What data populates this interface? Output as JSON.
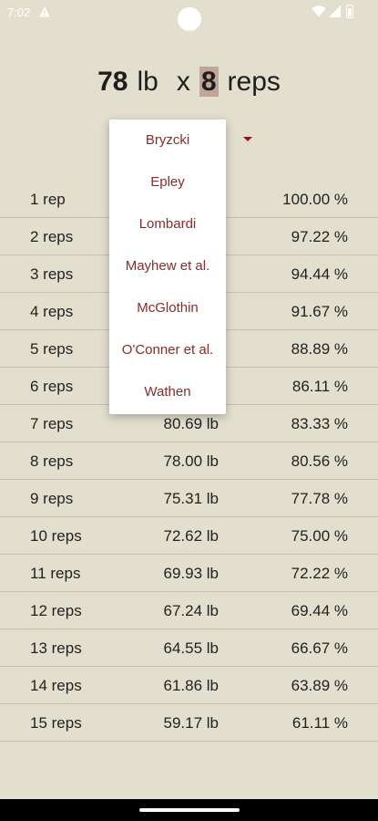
{
  "status_bar": {
    "time": "7:02"
  },
  "header": {
    "weight_value": "78",
    "weight_unit": "lb",
    "times": "x",
    "reps_value": "8",
    "reps_unit": "reps"
  },
  "formula_menu": {
    "options": [
      "Bryzcki",
      "Epley",
      "Lombardi",
      "Mayhew et al.",
      "McGlothin",
      "O'Conner et al.",
      "Wathen"
    ]
  },
  "rows": [
    {
      "reps": "1 rep",
      "weight": "",
      "percent": "100.00 %"
    },
    {
      "reps": "2 reps",
      "weight": "",
      "percent": "97.22 %"
    },
    {
      "reps": "3 reps",
      "weight": "",
      "percent": "94.44 %"
    },
    {
      "reps": "4 reps",
      "weight": "",
      "percent": "91.67 %"
    },
    {
      "reps": "5 reps",
      "weight": "",
      "percent": "88.89 %"
    },
    {
      "reps": "6 reps",
      "weight": "",
      "percent": "86.11 %"
    },
    {
      "reps": "7 reps",
      "weight": "80.69 lb",
      "percent": "83.33 %"
    },
    {
      "reps": "8 reps",
      "weight": "78.00 lb",
      "percent": "80.56 %"
    },
    {
      "reps": "9 reps",
      "weight": "75.31 lb",
      "percent": "77.78 %"
    },
    {
      "reps": "10 reps",
      "weight": "72.62 lb",
      "percent": "75.00 %"
    },
    {
      "reps": "11 reps",
      "weight": "69.93 lb",
      "percent": "72.22 %"
    },
    {
      "reps": "12 reps",
      "weight": "67.24 lb",
      "percent": "69.44 %"
    },
    {
      "reps": "13 reps",
      "weight": "64.55 lb",
      "percent": "66.67 %"
    },
    {
      "reps": "14 reps",
      "weight": "61.86 lb",
      "percent": "63.89 %"
    },
    {
      "reps": "15 reps",
      "weight": "59.17 lb",
      "percent": "61.11 %"
    }
  ],
  "colors": {
    "background": "#e2dfce",
    "accent": "#8b2a2a",
    "reps_highlight": "#c2a596"
  }
}
